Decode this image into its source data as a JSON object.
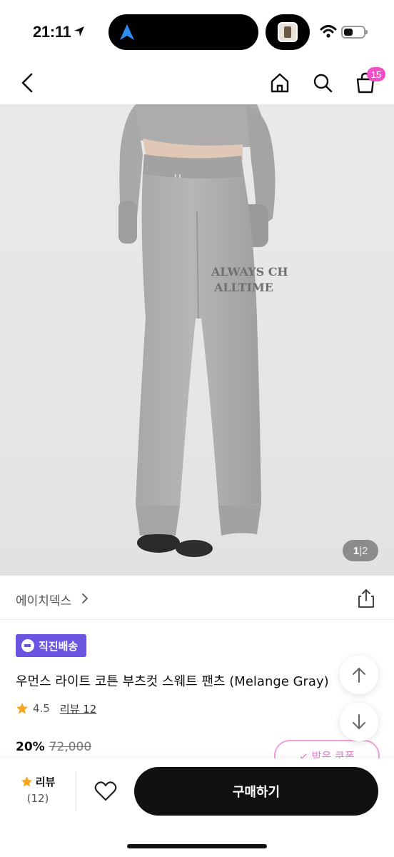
{
  "status_bar": {
    "time": "21:11"
  },
  "nav": {
    "cart_count": "15"
  },
  "image": {
    "current": "1",
    "separator": "|",
    "total": "2",
    "print_line1": "ALWAYS CH",
    "print_line2": "ALLTIME"
  },
  "brand": {
    "name": "에이치덱스"
  },
  "product": {
    "delivery_badge": "직진배송",
    "title": "우먼스 라이트 코튼 부츠컷 스웨트 팬츠 (Melange Gray)",
    "rating": "4.5",
    "review_link": "리뷰 12",
    "discount": "20%",
    "original_price": "72,000",
    "coupon_label": "↙ 받은 쿠폰"
  },
  "bottom_bar": {
    "review_label": "리뷰",
    "review_count": "(12)",
    "buy_label": "구매하기"
  },
  "colors": {
    "accent": "#6b54e0",
    "badge": "#f050c8",
    "star": "#f5a623",
    "dark": "#111111"
  }
}
